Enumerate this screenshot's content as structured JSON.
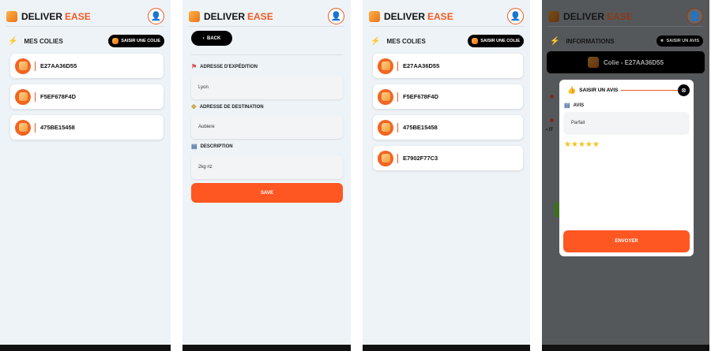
{
  "app": {
    "brand_a": "DELIVER",
    "brand_b": "EASE",
    "avatar": "user-avatar"
  },
  "screen1": {
    "section": "MES COLIES",
    "add_button": "SAISIR UNE COLIE",
    "items": [
      "E27AA36D55",
      "F5EF678F4D",
      "475BE15458"
    ]
  },
  "screen2": {
    "back": "BACK",
    "fields": [
      {
        "label": "ADRESSE D'EXPÉDITION",
        "value": "Lyon"
      },
      {
        "label": "ADRESSE DE DESTINATION",
        "value": "Aubiere"
      },
      {
        "label": "DESCRIPTION",
        "value": "2kg riz"
      }
    ],
    "save": "SAVE"
  },
  "screen3": {
    "section": "MES COLIES",
    "add_button": "SAISIR UNE COLIE",
    "items": [
      "E27AA36D55",
      "F5EF678F4D",
      "475BE15458",
      "E7902F77C3"
    ]
  },
  "screen4": {
    "section": "INFORMATIONS",
    "review_button": "SAISIR UN AVIS",
    "colie_title": "Colie - E27AA36D55",
    "bg_text": "• IT",
    "modal": {
      "title": "SAISIR UN AVIS",
      "label": "AVIS",
      "value": "Parfait",
      "rating": 5,
      "max_rating": 5,
      "submit": "ENVOYER"
    }
  },
  "colors": {
    "accent": "#ff5722",
    "star": "#f7c21a"
  }
}
